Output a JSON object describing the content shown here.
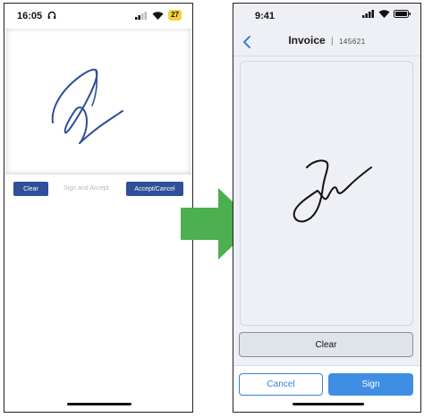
{
  "left_phone": {
    "status": {
      "time": "16:05",
      "battery": "27"
    },
    "toolbar": {
      "clear_label": "Clear",
      "sign_label": "Sign and Accept",
      "accept_label": "Accept/Cancel"
    },
    "colors": {
      "button": "#2f4f98",
      "signature": "#2f4f98"
    }
  },
  "arrow": {
    "color": "#4caf50",
    "icon": "right-arrow-icon"
  },
  "right_phone": {
    "status": {
      "time": "9:41"
    },
    "nav": {
      "title": "Invoice",
      "separator": "|",
      "number": "145621"
    },
    "clear_label": "Clear",
    "cancel_label": "Cancel",
    "sign_label": "Sign",
    "colors": {
      "accent": "#3f8ee3",
      "signature": "#111111"
    }
  }
}
